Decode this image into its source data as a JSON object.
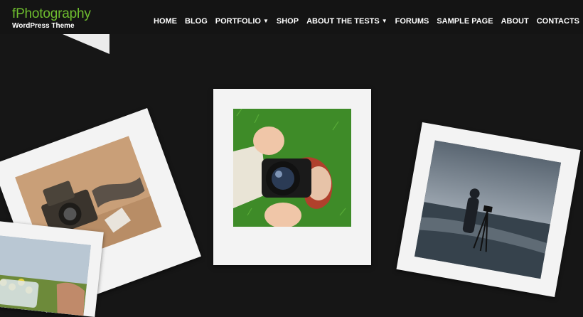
{
  "site": {
    "title": "fPhotography",
    "tagline": "WordPress Theme"
  },
  "nav": {
    "items": [
      {
        "label": "HOME",
        "has_dropdown": false
      },
      {
        "label": "BLOG",
        "has_dropdown": false
      },
      {
        "label": "PORTFOLIO",
        "has_dropdown": true
      },
      {
        "label": "SHOP",
        "has_dropdown": false
      },
      {
        "label": "ABOUT THE TESTS",
        "has_dropdown": true
      },
      {
        "label": "FORUMS",
        "has_dropdown": false
      },
      {
        "label": "SAMPLE PAGE",
        "has_dropdown": false
      },
      {
        "label": "ABOUT",
        "has_dropdown": false
      },
      {
        "label": "CONTACTS",
        "has_dropdown": false
      }
    ]
  },
  "colors": {
    "background": "#161616",
    "brand": "#6fbe2f",
    "nav_text": "#ffffff",
    "polaroid_frame": "#f3f3f3"
  },
  "photos": {
    "icons": [
      "vintage-camera-photo",
      "person-with-camera-photo",
      "photographer-on-beach-photo",
      "flowers-phone-photo"
    ]
  }
}
